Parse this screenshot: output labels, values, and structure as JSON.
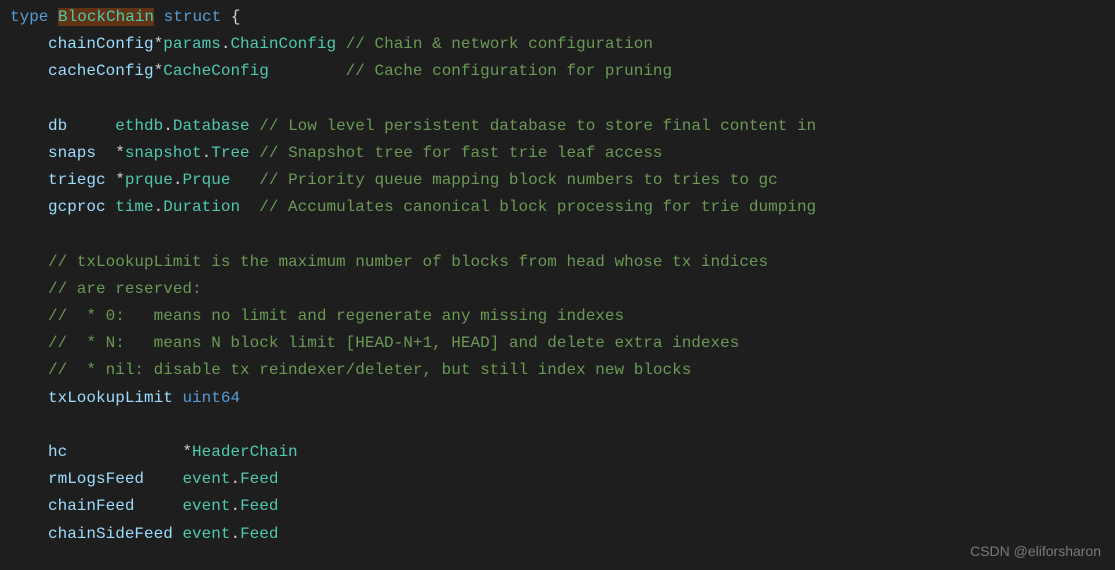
{
  "declaration": {
    "keyword_type": "type",
    "struct_name": "BlockChain",
    "keyword_struct": "struct",
    "open_brace": "{"
  },
  "lines": [
    {
      "indent": 1,
      "field": "chainConfig",
      "type_prefix": "*",
      "type_pkg": "params",
      "type_name": "ChainConfig",
      "pad": " ",
      "comment": "// Chain & network configuration"
    },
    {
      "indent": 1,
      "field": "cacheConfig",
      "type_prefix": "*",
      "type_pkg": "",
      "type_name": "CacheConfig",
      "pad": "        ",
      "comment": "// Cache configuration for pruning"
    },
    {
      "blank": true
    },
    {
      "indent": 1,
      "field": "db",
      "field_pad": "    ",
      "type_prefix": " ",
      "type_pkg": "ethdb",
      "type_name": "Database",
      "pad": " ",
      "comment": "// Low level persistent database to store final content in"
    },
    {
      "indent": 1,
      "field": "snaps",
      "field_pad": " ",
      "type_prefix": " *",
      "type_pkg": "snapshot",
      "type_name": "Tree",
      "pad": " ",
      "comment": "// Snapshot tree for fast trie leaf access"
    },
    {
      "indent": 1,
      "field": "triegc",
      "field_pad": "",
      "type_prefix": " *",
      "type_pkg": "prque",
      "type_name": "Prque",
      "pad": "   ",
      "comment": "// Priority queue mapping block numbers to tries to gc"
    },
    {
      "indent": 1,
      "field": "gcproc",
      "field_pad": "",
      "type_prefix": " ",
      "type_pkg": "time",
      "type_name": "Duration",
      "pad": "  ",
      "comment": "// Accumulates canonical block processing for trie dumping"
    },
    {
      "blank": true
    },
    {
      "indent": 1,
      "comment_only": "// txLookupLimit is the maximum number of blocks from head whose tx indices"
    },
    {
      "indent": 1,
      "comment_only": "// are reserved:"
    },
    {
      "indent": 1,
      "comment_only": "//  * 0:   means no limit and regenerate any missing indexes"
    },
    {
      "indent": 1,
      "comment_only": "//  * N:   means N block limit [HEAD-N+1, HEAD] and delete extra indexes"
    },
    {
      "indent": 1,
      "comment_only": "//  * nil: disable tx reindexer/deleter, but still index new blocks"
    },
    {
      "indent": 1,
      "field": "txLookupLimit",
      "type_prefix": " ",
      "type_pkg": "",
      "type_name": "uint64",
      "type_is_builtin": true
    },
    {
      "blank": true
    },
    {
      "indent": 1,
      "field": "hc",
      "field_pad": "           ",
      "type_prefix": " *",
      "type_pkg": "",
      "type_name": "HeaderChain"
    },
    {
      "indent": 1,
      "field": "rmLogsFeed",
      "field_pad": "   ",
      "type_prefix": " ",
      "type_pkg": "event",
      "type_name": "Feed"
    },
    {
      "indent": 1,
      "field": "chainFeed",
      "field_pad": "    ",
      "type_prefix": " ",
      "type_pkg": "event",
      "type_name": "Feed"
    },
    {
      "indent": 1,
      "field": "chainSideFeed",
      "field_pad": "",
      "type_prefix": " ",
      "type_pkg": "event",
      "type_name": "Feed"
    }
  ],
  "watermark": "CSDN @eliforsharon"
}
